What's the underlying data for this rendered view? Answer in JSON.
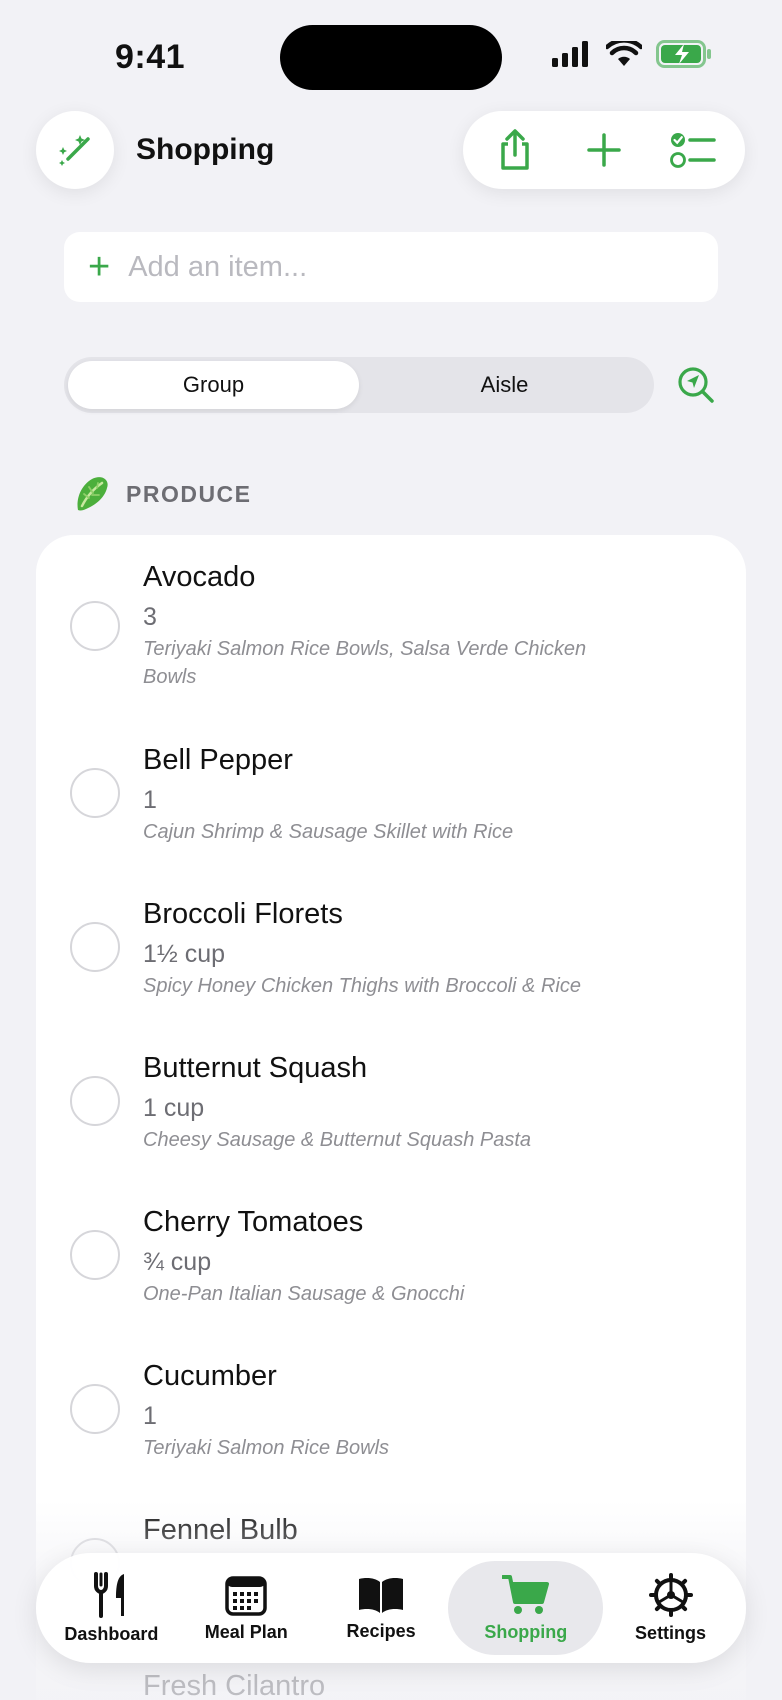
{
  "status_bar": {
    "time": "9:41"
  },
  "header": {
    "title": "Shopping"
  },
  "add_item": {
    "placeholder": "Add an item..."
  },
  "segmented": {
    "options": [
      "Group",
      "Aisle"
    ],
    "selected": "Group"
  },
  "section": {
    "label": "PRODUCE",
    "icon": "lettuce-icon"
  },
  "items": [
    {
      "name": "Avocado",
      "qty": "3",
      "recipes": "Teriyaki Salmon Rice Bowls, Salsa Verde Chicken Bowls"
    },
    {
      "name": "Bell Pepper",
      "qty": "1",
      "recipes": "Cajun Shrimp & Sausage Skillet with Rice"
    },
    {
      "name": "Broccoli Florets",
      "qty": "1½ cup",
      "recipes": "Spicy Honey Chicken Thighs with Broccoli & Rice"
    },
    {
      "name": "Butternut Squash",
      "qty": "1 cup",
      "recipes": "Cheesy Sausage & Butternut Squash Pasta"
    },
    {
      "name": "Cherry Tomatoes",
      "qty": "¾ cup",
      "recipes": "One-Pan Italian Sausage & Gnocchi"
    },
    {
      "name": "Cucumber",
      "qty": "1",
      "recipes": "Teriyaki Salmon Rice Bowls"
    },
    {
      "name": "Fennel Bulb",
      "qty": "",
      "recipes": ""
    },
    {
      "name": "Fresh Cilantro",
      "qty": "",
      "recipes": ""
    }
  ],
  "tabs": [
    {
      "label": "Dashboard",
      "icon": "fork-knife-icon"
    },
    {
      "label": "Meal Plan",
      "icon": "calendar-icon"
    },
    {
      "label": "Recipes",
      "icon": "book-icon"
    },
    {
      "label": "Shopping",
      "icon": "cart-icon",
      "active": true
    },
    {
      "label": "Settings",
      "icon": "gear-icon"
    }
  ],
  "colors": {
    "accent": "#3aa84a",
    "background": "#f2f2f6",
    "card": "#ffffff",
    "muted_text": "#8e8e93"
  }
}
